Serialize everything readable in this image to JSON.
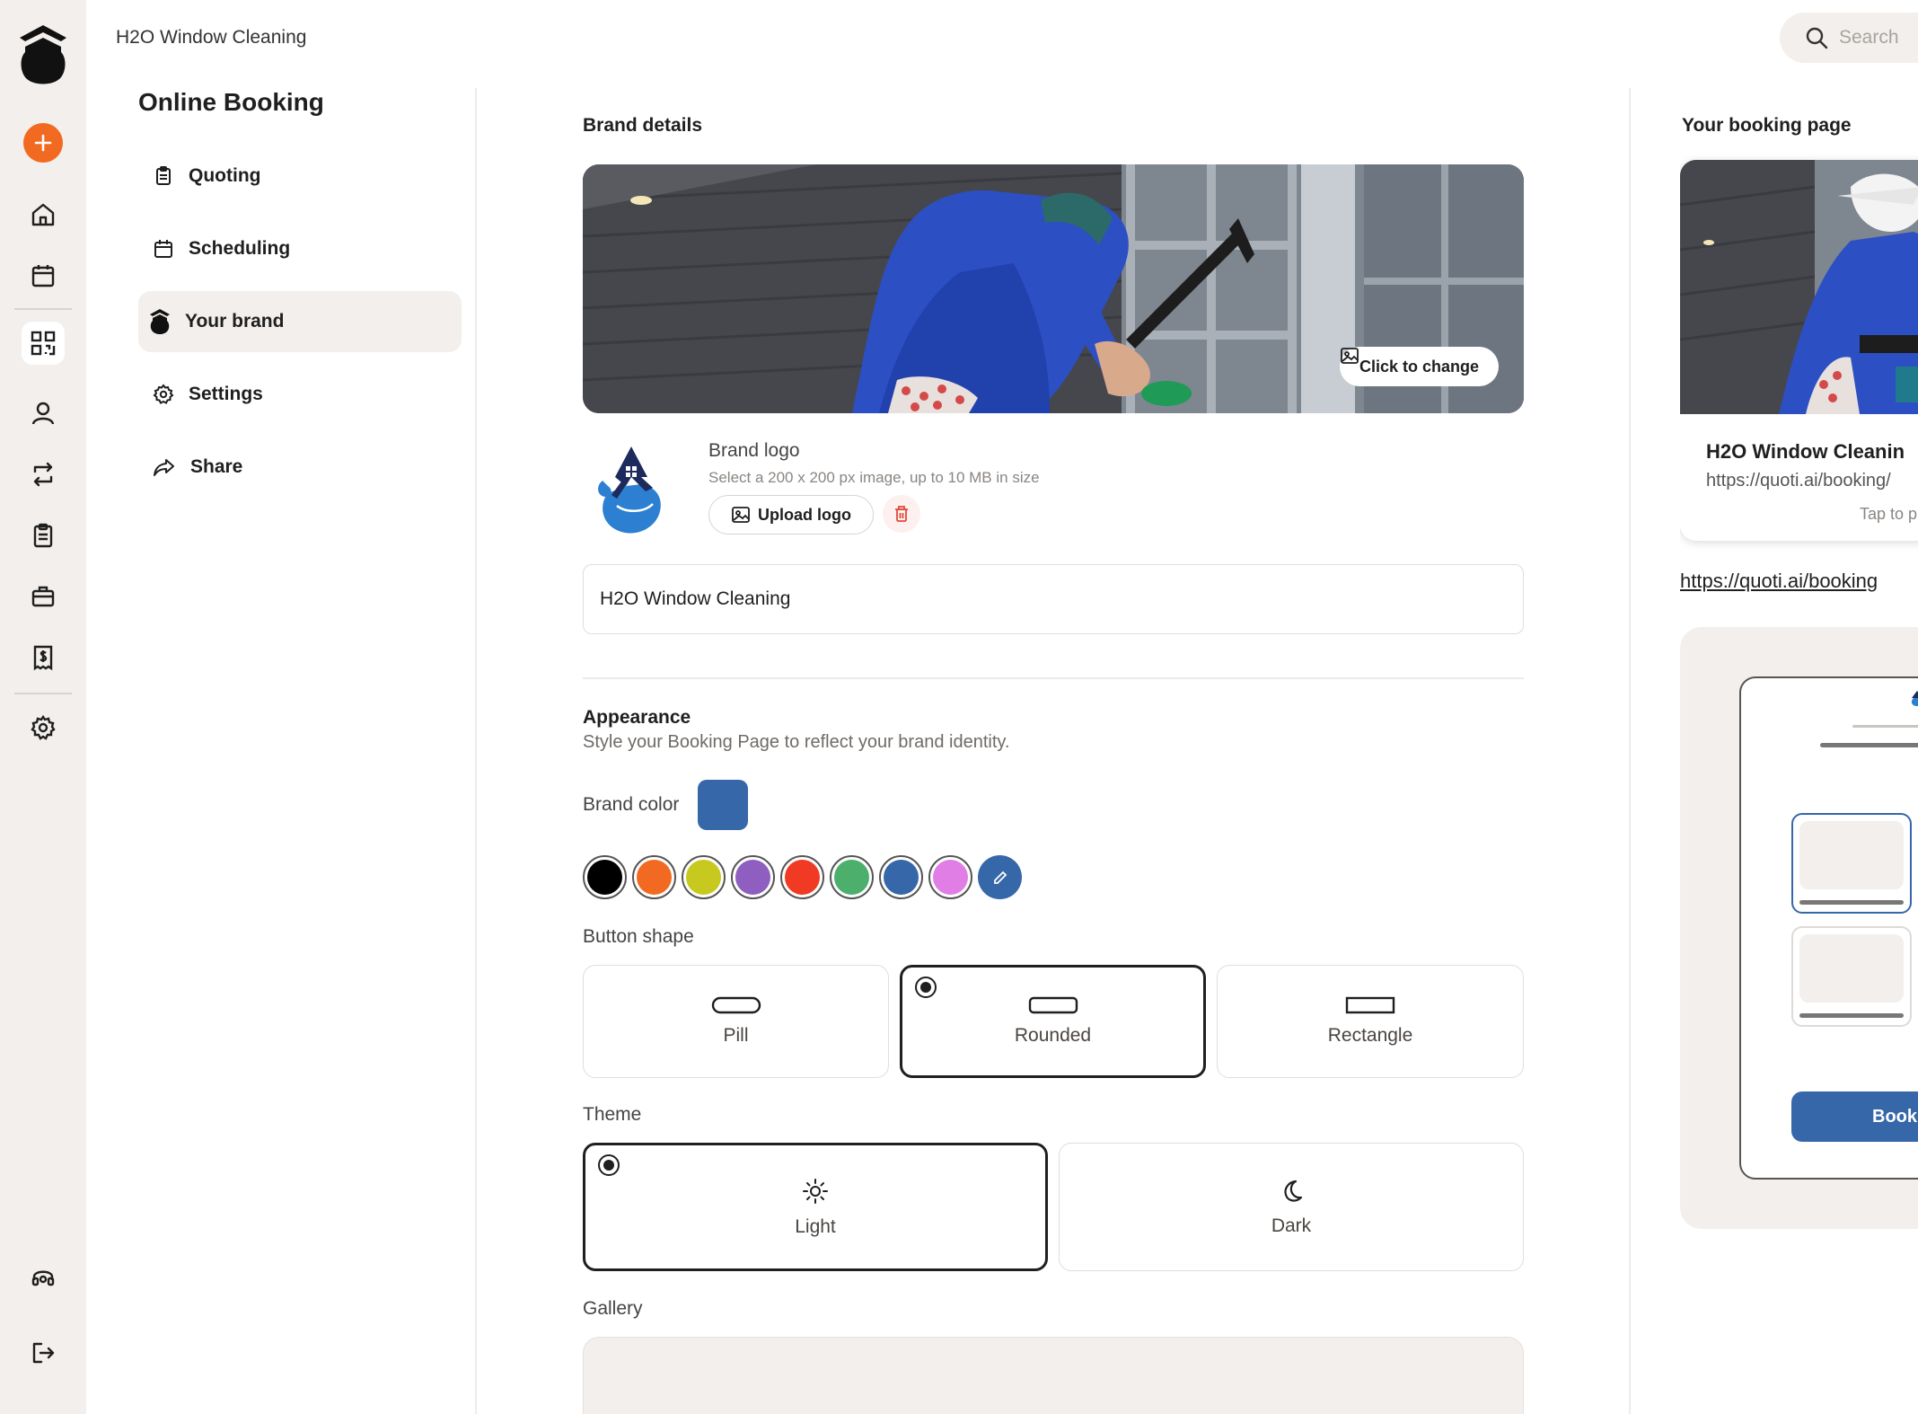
{
  "app": {
    "business_name": "H2O Window Cleaning"
  },
  "search": {
    "placeholder": "Search"
  },
  "subnav": {
    "title": "Online Booking",
    "items": [
      {
        "label": "Quoting",
        "icon": "clipboard-icon"
      },
      {
        "label": "Scheduling",
        "icon": "calendar-icon"
      },
      {
        "label": "Your brand",
        "icon": "brand-logo-icon",
        "active": true
      },
      {
        "label": "Settings",
        "icon": "gear-icon"
      },
      {
        "label": "Share",
        "icon": "share-icon"
      }
    ]
  },
  "brand": {
    "section_title": "Brand details",
    "change_label": "Click to change",
    "logo_label": "Brand logo",
    "logo_help": "Select a 200 x 200 px image, up to 10 MB in size",
    "upload_label": "Upload logo",
    "business_name_value": "H2O Window Cleaning"
  },
  "appearance": {
    "title": "Appearance",
    "subtitle": "Style your Booking Page to reflect your brand identity.",
    "brand_color_label": "Brand color",
    "brand_color": "#3667a8",
    "palette": [
      "#000000",
      "#f26a21",
      "#c7c91f",
      "#8e5fc0",
      "#f03a24",
      "#4caf6c",
      "#3667a8",
      "#e07ee6"
    ],
    "button_shape_label": "Button shape",
    "shapes": [
      {
        "label": "Pill",
        "selected": false
      },
      {
        "label": "Rounded",
        "selected": true
      },
      {
        "label": "Rectangle",
        "selected": false
      }
    ],
    "theme_label": "Theme",
    "themes": [
      {
        "label": "Light",
        "selected": true,
        "icon": "sun-icon"
      },
      {
        "label": "Dark",
        "selected": false,
        "icon": "moon-icon"
      }
    ],
    "gallery_label": "Gallery"
  },
  "preview": {
    "title": "Your booking page",
    "card_name": "H2O Window Cleanin",
    "card_url": "https://quoti.ai/booking/",
    "card_tap": "Tap to p",
    "link": "https://quoti.ai/booking",
    "book_label": "Book"
  },
  "colors": {
    "accent": "#f26a21",
    "brand": "#3667a8",
    "surface": "#f2efec"
  }
}
